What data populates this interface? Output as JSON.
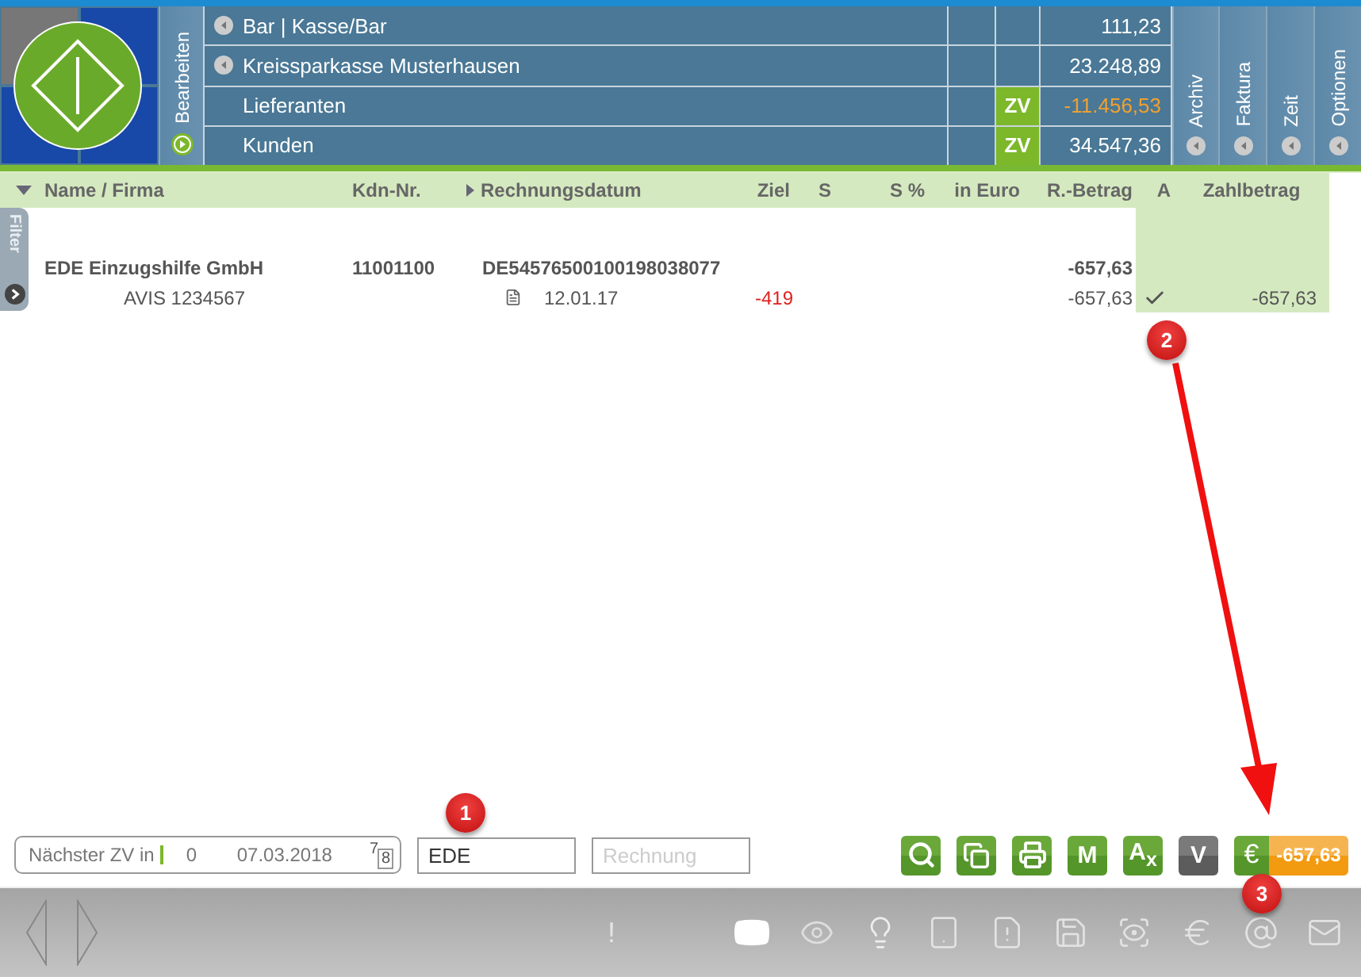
{
  "header": {
    "side_tab": "Bearbeiten",
    "accounts": [
      {
        "label": "Bar | Kasse/Bar",
        "expandable": true,
        "amount": "111,23",
        "negative": false
      },
      {
        "label": "Kreissparkasse Musterhausen",
        "expandable": true,
        "amount": "23.248,89",
        "negative": false
      },
      {
        "label": "Lieferanten",
        "expandable": false,
        "badge": "ZV",
        "amount": "-11.456,53",
        "negative": true
      },
      {
        "label": "Kunden",
        "expandable": false,
        "badge": "ZV",
        "amount": "34.547,36",
        "negative": false
      }
    ],
    "tabs": [
      "Archiv",
      "Faktura",
      "Zeit",
      "Optionen"
    ]
  },
  "filter_tab": "Filter",
  "table": {
    "columns": [
      "Name / Firma",
      "Kdn-Nr.",
      "Rechnungsdatum",
      "Ziel",
      "S",
      "S %",
      "in Euro",
      "R.-Betrag",
      "A",
      "Zahlbetrag"
    ],
    "rows": [
      {
        "kind": "summary",
        "name": "EDE Einzugshilfe GmbH",
        "kdn": "11001100",
        "rechnungsdatum": "DE54576500100198038077",
        "r_betrag": "-657,63",
        "checked": false
      },
      {
        "kind": "item",
        "name": "AVIS 1234567",
        "rechnungsdatum": "12.01.17",
        "ziel": "-419",
        "r_betrag": "-657,63",
        "checked": true,
        "zahlbetrag": "-657,63"
      }
    ]
  },
  "bottom_bar": {
    "zv_label": "Nächster ZV in",
    "zv_count": "0",
    "zv_date": "07.03.2018",
    "calendar": [
      "7",
      "8"
    ],
    "search_value": "EDE",
    "invoice_placeholder": "Rechnung",
    "buttons": [
      {
        "kind": "search",
        "disabled": false
      },
      {
        "kind": "copy",
        "disabled": false
      },
      {
        "kind": "print",
        "disabled": false
      },
      {
        "kind": "text",
        "label": "M",
        "disabled": false
      },
      {
        "kind": "text",
        "label": "A$_{x}$",
        "disabled": false
      },
      {
        "kind": "text",
        "label": "V",
        "disabled": true
      }
    ],
    "pay": {
      "symbol": "€",
      "amount": "-657,63"
    }
  },
  "footer": {
    "alert": "!"
  },
  "annotations": [
    "1",
    "2",
    "3"
  ]
}
